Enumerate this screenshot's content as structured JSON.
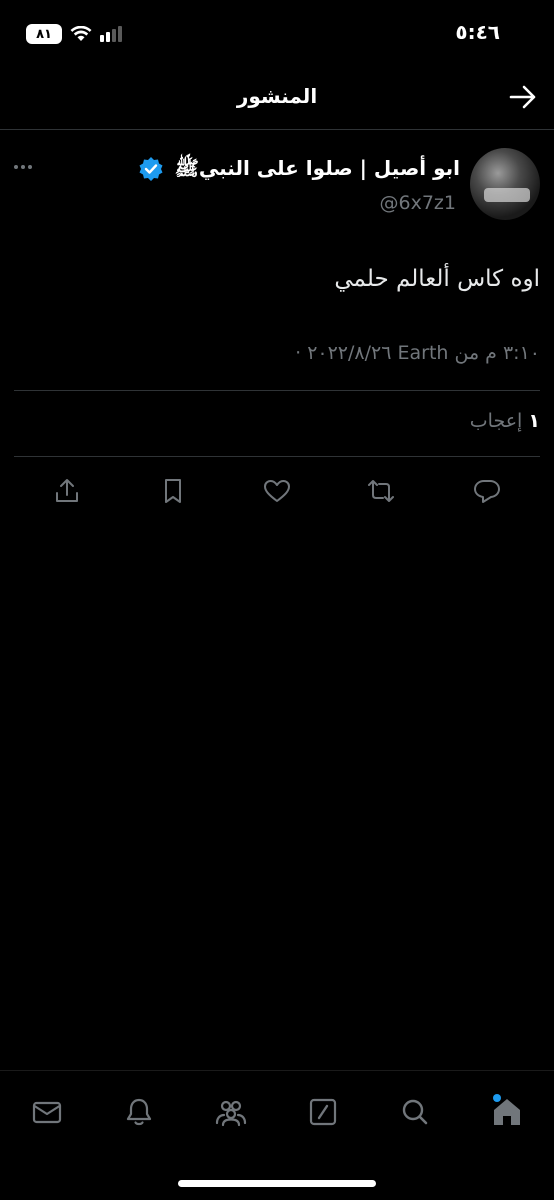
{
  "status_bar": {
    "time": "٥:٤٦",
    "battery": "٨١"
  },
  "header": {
    "title": "المنشور"
  },
  "post": {
    "author_name": "ابو أصيل | صلوا على النبيﷺ",
    "handle": "@6x7z1",
    "text": "اوه كاس ألعالم حلمي",
    "meta": "٣:١٠ م من Earth ٢٠٢٢/٨/٢٦ ·",
    "likes_count": "١",
    "likes_label": "إعجاب"
  },
  "icons": {
    "back": "arrow-right-icon",
    "verified": "verified-badge-icon",
    "more": "more-dots-icon",
    "reply": "reply-icon",
    "retweet": "retweet-icon",
    "like": "heart-icon",
    "bookmark": "bookmark-icon",
    "share": "share-icon",
    "nav": [
      "home-icon",
      "search-icon",
      "compose-icon",
      "communities-icon",
      "notifications-icon",
      "messages-icon"
    ]
  },
  "colors": {
    "background": "#000000",
    "text": "#e7e9ea",
    "muted": "#71767b",
    "accent": "#1d9bf0",
    "divider": "#2f3336"
  }
}
